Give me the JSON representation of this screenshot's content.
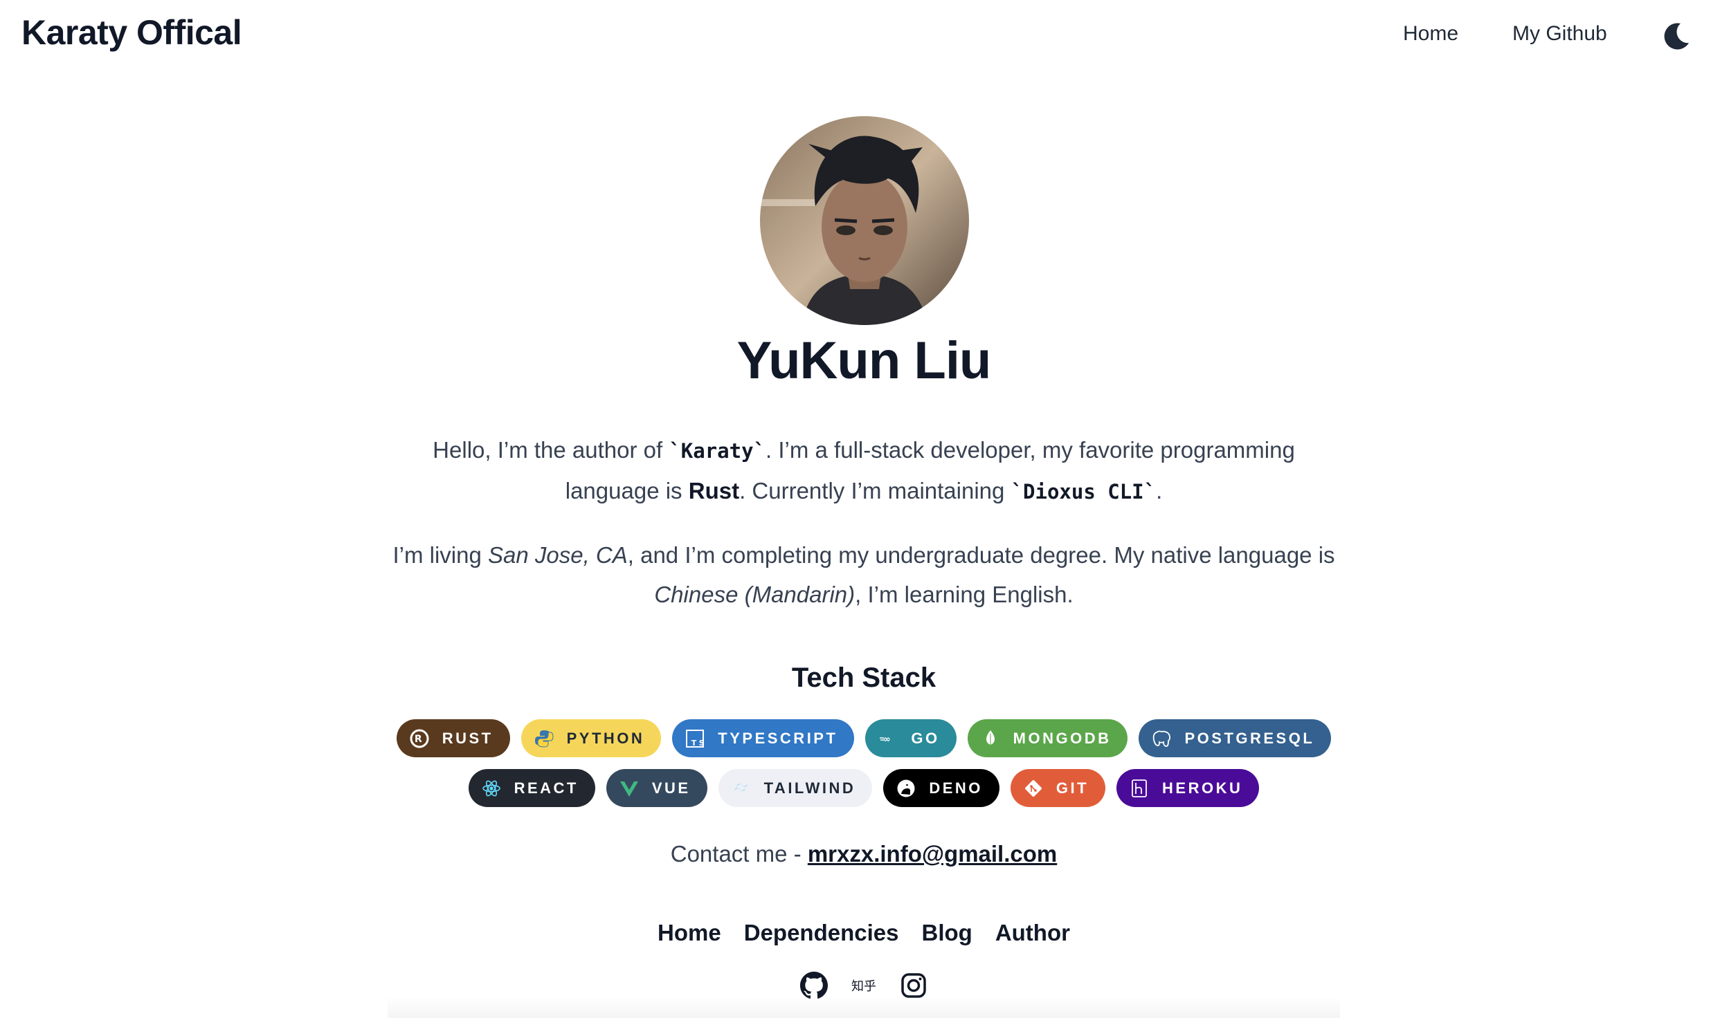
{
  "header": {
    "site_title": "Karaty Offical",
    "nav": [
      "Home",
      "My Github"
    ]
  },
  "profile": {
    "name": "YuKun Liu"
  },
  "bio": {
    "p1": {
      "a": "Hello, I’m the author of ",
      "code1": "`Karaty`",
      "b": ". I’m a full-stack developer, my favorite programming language is ",
      "strong": "Rust",
      "c": ". Currently I’m maintaining ",
      "code2": "`Dioxus CLI`",
      "d": "."
    },
    "p2": {
      "a": "I’m living ",
      "em1": "San Jose, CA",
      "b": ", and I’m completing my undergraduate degree. My native language is ",
      "em2": "Chinese (Mandarin)",
      "c": ", I’m learning English."
    }
  },
  "tech_stack": {
    "title": "Tech Stack",
    "row1": [
      {
        "label": "RUST",
        "bg": "#5a3a1e",
        "fg": "#ffffff",
        "icon": "rust-icon"
      },
      {
        "label": "PYTHON",
        "bg": "#f6d65a",
        "fg": "#1f2937",
        "icon": "python-icon"
      },
      {
        "label": "TYPESCRIPT",
        "bg": "#3178c6",
        "fg": "#ffffff",
        "icon": "typescript-icon"
      },
      {
        "label": "GO",
        "bg": "#2a8b9a",
        "fg": "#ffffff",
        "icon": "go-icon"
      },
      {
        "label": "MONGODB",
        "bg": "#5ba64a",
        "fg": "#ffffff",
        "icon": "mongodb-icon"
      },
      {
        "label": "POSTGRESQL",
        "bg": "#34618f",
        "fg": "#ffffff",
        "icon": "postgresql-icon"
      }
    ],
    "row2": [
      {
        "label": "REACT",
        "bg": "#23272f",
        "fg": "#ffffff",
        "icon": "react-icon"
      },
      {
        "label": "VUE",
        "bg": "#35495e",
        "fg": "#ffffff",
        "icon": "vue-icon"
      },
      {
        "label": "TAILWIND",
        "bg": "#eef0f6",
        "fg": "#1f2937",
        "icon": "tailwind-icon"
      },
      {
        "label": "DENO",
        "bg": "#000000",
        "fg": "#ffffff",
        "icon": "deno-icon"
      },
      {
        "label": "GIT",
        "bg": "#e15d3a",
        "fg": "#ffffff",
        "icon": "git-icon"
      },
      {
        "label": "HEROKU",
        "bg": "#4b0b99",
        "fg": "#ffffff",
        "icon": "heroku-icon"
      }
    ]
  },
  "contact": {
    "label": "Contact me - ",
    "email": "mrxzx.info@gmail.com"
  },
  "footer": {
    "nav": [
      "Home",
      "Dependencies",
      "Blog",
      "Author"
    ],
    "social": {
      "zhihu_label": "知乎"
    }
  }
}
